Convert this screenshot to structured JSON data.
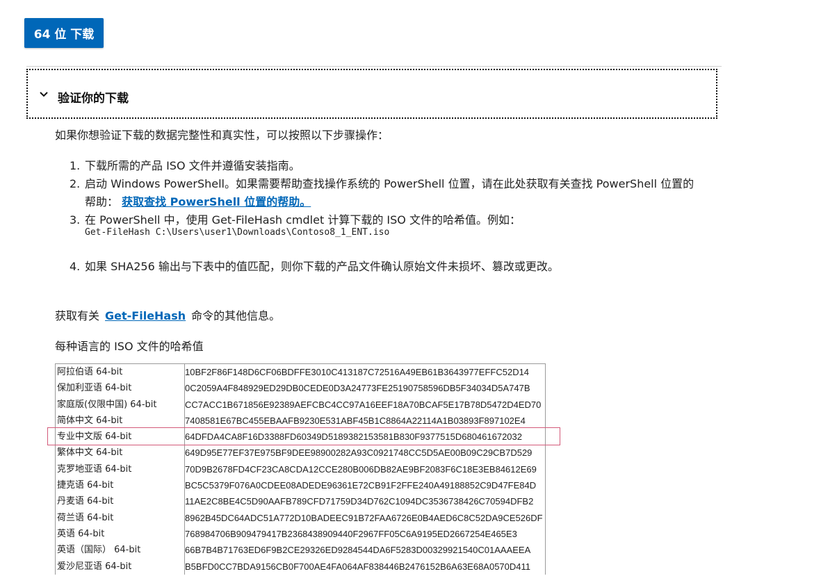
{
  "download_button": {
    "label": "64 位 下载"
  },
  "accordion": {
    "title": "验证你的下载"
  },
  "intro": "如果你想验证下载的数据完整性和真实性，可以按照以下步骤操作：",
  "steps": [
    {
      "num": "1.",
      "text": "下载所需的产品 ISO 文件并遵循安装指南。"
    },
    {
      "num": "2.",
      "text": "启动 Windows PowerShell。如果需要帮助查找操作系统的 PowerShell 位置，请在此处获取有关查找 PowerShell 位置的",
      "cont_prefix": "帮助：",
      "link": "获取查找 PowerShell 位置的帮助。"
    },
    {
      "num": "3.",
      "text": "在 PowerShell 中，使用 Get-FileHash cmdlet 计算下载的 ISO 文件的哈希值。例如：",
      "code": "Get-FileHash C:\\Users\\user1\\Downloads\\Contoso8_1_ENT.iso"
    },
    {
      "num": "4.",
      "text": "如果 SHA256 输出与下表中的值匹配，则你下载的产品文件确认原始文件未损坏、篡改或更改。"
    }
  ],
  "more_info": {
    "prefix": "获取有关",
    "link": "Get-FileHash",
    "suffix": "命令的其他信息。"
  },
  "hash_heading": "每种语言的 ISO 文件的哈希值",
  "hash_table": [
    {
      "lang": "阿拉伯语 64-bit",
      "hash": "10BF2F86F148D6CF06BDFFE3010C413187C72516A49EB61B3643977EFFC52D14"
    },
    {
      "lang": "保加利亚语 64-bit",
      "hash": "0C2059A4F848929ED29DB0CEDE0D3A24773FE25190758596DB5F34034D5A747B"
    },
    {
      "lang": "家庭版(仅限中国) 64-bit",
      "hash": "CC7ACC1B671856E92389AEFCBC4CC97A16EEF18A70BCAF5E17B78D5472D4ED70"
    },
    {
      "lang": "简体中文 64-bit",
      "hash": "7408581E67BC455EBAAFB9230E531ABF45B1C8864A22114A1B03893F897102E4"
    },
    {
      "lang": "专业中文版 64-bit",
      "hash": "64DFDA4CA8F16D3388FD60349D5189382153581B830F9377515D680461672032"
    },
    {
      "lang": "繁体中文 64-bit",
      "hash": "649D95E77EF37E975BF9DEE98900282A93C0921748CC5D5AE00B09C29CB7D529"
    },
    {
      "lang": "克罗地亚语 64-bit",
      "hash": "70D9B2678FD4CF23CA8CDA12CCE280B006DB82AE9BF2083F6C18E3EB84612E69"
    },
    {
      "lang": "捷克语 64-bit",
      "hash": "BC5C5379F076A0CDEE08ADEDE96361E72CB91F2FFE240A49188852C9D47FE84D"
    },
    {
      "lang": "丹麦语 64-bit",
      "hash": "11AE2C8BE4C5D90AAFB789CFD71759D34D762C1094DC3536738426C70594DFB2"
    },
    {
      "lang": "荷兰语 64-bit",
      "hash": "8962B45DC64ADC51A772D10BADEEC91B72FAA6726E0B4AED6C8C52DA9CE526DF"
    },
    {
      "lang": "英语 64-bit",
      "hash": "768984706B909479417B2368438909440F2967FF05C6A9195ED2667254E465E3"
    },
    {
      "lang": "英语（国际） 64-bit",
      "hash": "66B7B4B71763ED6F9B2CE29326ED9284544DA6F5283D00329921540C01AAAEEA"
    },
    {
      "lang": "爱沙尼亚语 64-bit",
      "hash": "B5BFD0CC7BDA9156CB0F700AE4FA064AF838446B2476152B6A63E68A0570D411"
    }
  ],
  "colors": {
    "accent": "#0067b8",
    "highlight": "#d35a7a"
  },
  "icons": {
    "accordion": "chevron-down-icon"
  }
}
